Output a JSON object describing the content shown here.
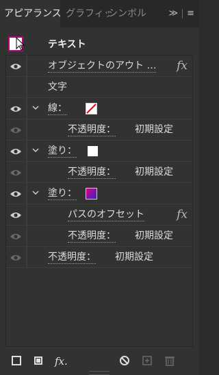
{
  "tabs": [
    {
      "label": "アピアランス"
    },
    {
      "label": "グラフィッ"
    },
    {
      "label": "シンボル"
    }
  ],
  "tab_controls": {
    "more": "≫",
    "menu": "≡"
  },
  "header": {
    "object_type": "テキスト"
  },
  "rows": [
    {
      "label": "オブジェクトのアウト …",
      "fx": "fx"
    },
    {
      "label": "文字"
    },
    {
      "label": "線：",
      "swatch": "none-slash"
    },
    {
      "label": "不透明度：",
      "value": "初期設定"
    },
    {
      "label": "塗り：",
      "swatch": "#ffffff"
    },
    {
      "label": "不透明度：",
      "value": "初期設定"
    },
    {
      "label": "塗り：",
      "swatch": "gradient-magenta-blue"
    },
    {
      "label": "パスのオフセット",
      "fx": "fx"
    },
    {
      "label": "不透明度：",
      "value": "初期設定"
    },
    {
      "label": "不透明度：",
      "value": "初期設定"
    }
  ],
  "footer": {
    "fx_label": "fx."
  },
  "colors": {
    "panel_bg": "#323232",
    "tab_bg": "#282828",
    "accent_magenta": "#c2007a",
    "gradient_start": "#e0007a",
    "gradient_end": "#3a1fd0"
  },
  "icons": [
    "eye-icon",
    "chevron-down-icon",
    "add-stroke-icon",
    "add-fill-icon",
    "fx-icon",
    "clear-appearance-icon",
    "duplicate-item-icon",
    "delete-item-icon"
  ]
}
